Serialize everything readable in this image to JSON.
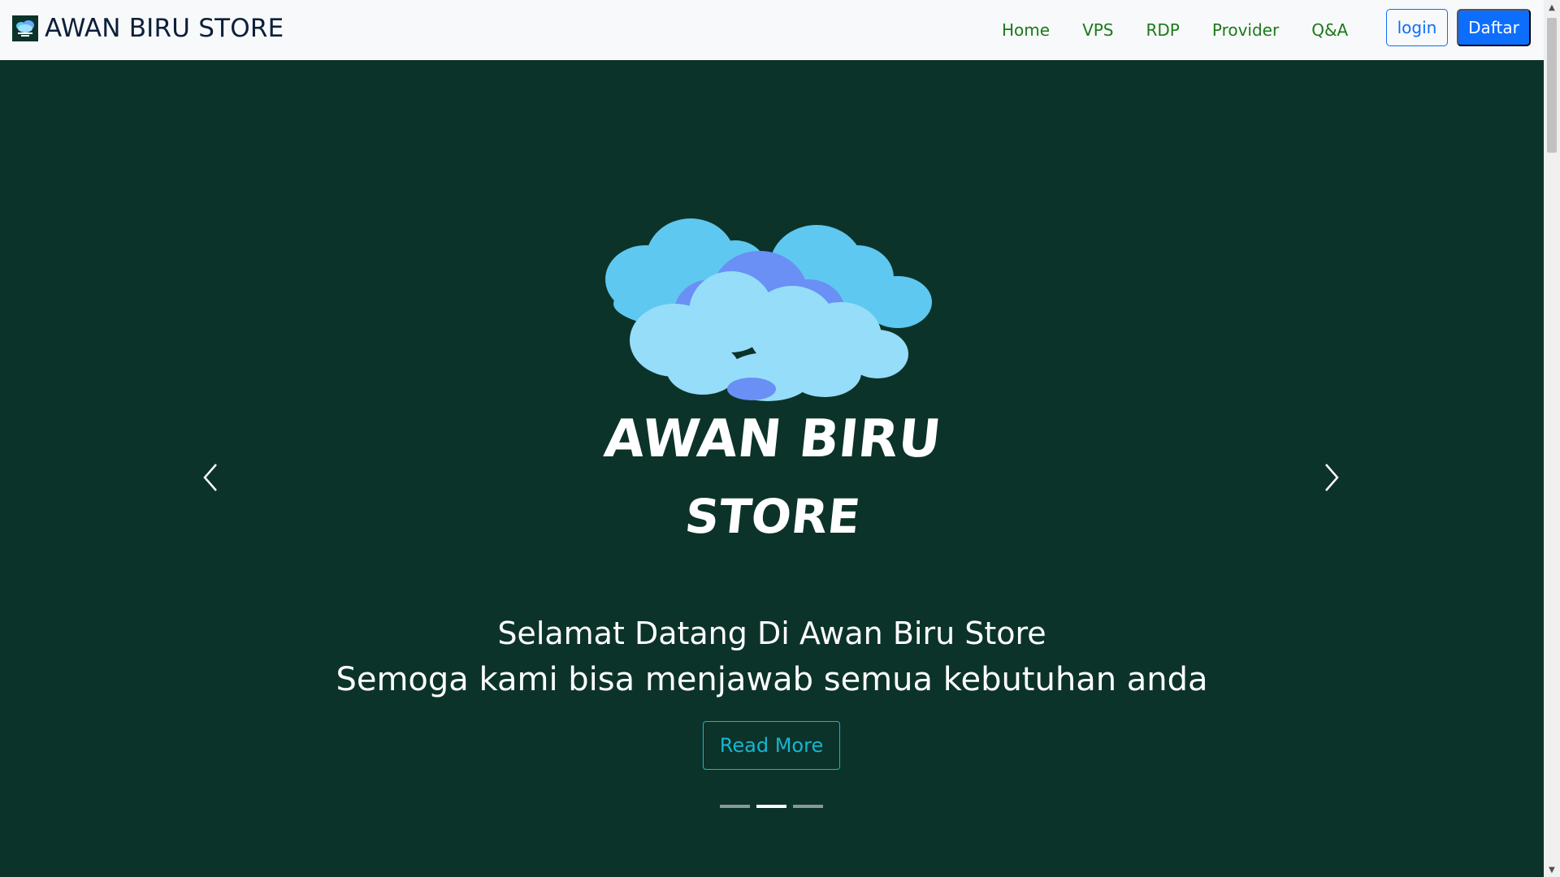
{
  "navbar": {
    "brand": "AWAN BIRU STORE",
    "links": [
      "Home",
      "VPS",
      "RDP",
      "Provider",
      "Q&A"
    ],
    "login_label": "login",
    "register_label": "Daftar"
  },
  "hero": {
    "logo_text_line1": "AWAN BIRU",
    "logo_text_line2": "STORE",
    "caption_line1": "Selamat Datang Di Awan Biru Store",
    "caption_line2": "Semoga kami bisa menjawab semua kebutuhan anda",
    "read_more_label": "Read More",
    "indicators": 3,
    "active_indicator": 2
  },
  "colors": {
    "hero_bg": "#0c3329",
    "nav_link": "#1a7a1a",
    "primary": "#0d6efd",
    "read_more": "#17b5d0"
  },
  "icons": {
    "prev": "chevron-left-icon",
    "next": "chevron-right-icon"
  }
}
